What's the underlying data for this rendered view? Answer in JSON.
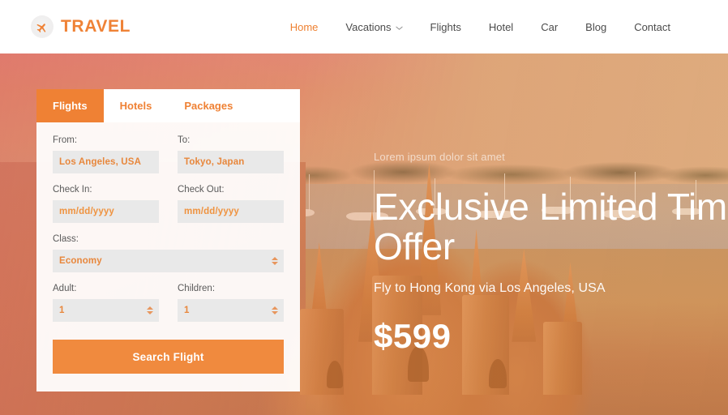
{
  "brand": {
    "name": "TRAVEL",
    "icon": "airplane-icon",
    "color": "#ef8236"
  },
  "nav": {
    "items": [
      {
        "label": "Home",
        "active": true,
        "caret": false
      },
      {
        "label": "Vacations",
        "active": false,
        "caret": true
      },
      {
        "label": "Flights",
        "active": false,
        "caret": false
      },
      {
        "label": "Hotel",
        "active": false,
        "caret": false
      },
      {
        "label": "Car",
        "active": false,
        "caret": false
      },
      {
        "label": "Blog",
        "active": false,
        "caret": false
      },
      {
        "label": "Contact",
        "active": false,
        "caret": false
      }
    ]
  },
  "hero": {
    "kicker": "Lorem ipsum dolor sit amet",
    "title": "Exclusive Limited Time\nOffer",
    "subtitle": "Fly to Hong Kong via Los Angeles, USA",
    "price": "$599",
    "background_description": "sand castle on beach with harbour and sailboats, warm orange tint"
  },
  "booking": {
    "tabs": [
      {
        "label": "Flights",
        "active": true
      },
      {
        "label": "Hotels",
        "active": false
      },
      {
        "label": "Packages",
        "active": false
      }
    ],
    "fields": {
      "from": {
        "label": "From:",
        "value": "Los Angeles, USA"
      },
      "to": {
        "label": "To:",
        "value": "Tokyo, Japan"
      },
      "check_in": {
        "label": "Check In:",
        "placeholder": "mm/dd/yyyy",
        "value": "mm/dd/yyyy"
      },
      "check_out": {
        "label": "Check Out:",
        "placeholder": "mm/dd/yyyy",
        "value": "mm/dd/yyyy"
      },
      "class": {
        "label": "Class:",
        "value": "Economy"
      },
      "adult": {
        "label": "Adult:",
        "value": "1"
      },
      "children": {
        "label": "Children:",
        "value": "1"
      }
    },
    "submit_label": "Search Flight"
  },
  "theme": {
    "accent": "#ef8134",
    "button": "#f08a3e",
    "input_bg": "#e9e9e9",
    "label_text": "#5a5a5a",
    "header_bg": "#ffffff"
  }
}
